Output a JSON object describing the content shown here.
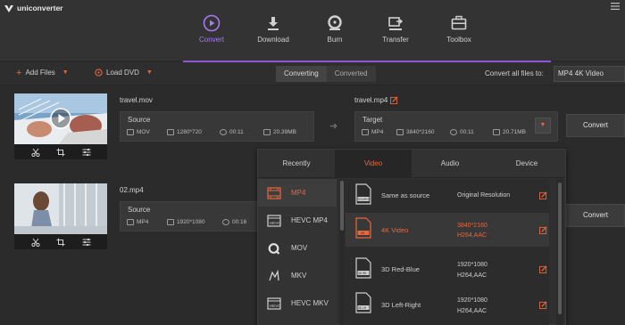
{
  "app": {
    "name": "uniconverter",
    "accent_color": "#8e59d8",
    "highlight_color": "#e8663e"
  },
  "nav": {
    "tabs": [
      {
        "label": "Convert",
        "icon": "convert-icon",
        "active": true
      },
      {
        "label": "Download",
        "icon": "download-icon",
        "active": false
      },
      {
        "label": "Burn",
        "icon": "burn-icon",
        "active": false
      },
      {
        "label": "Transfer",
        "icon": "transfer-icon",
        "active": false
      },
      {
        "label": "Toolbox",
        "icon": "toolbox-icon",
        "active": false
      }
    ]
  },
  "toolbar": {
    "add_files": "Add Files",
    "load_dvd": "Load DVD",
    "segments": [
      {
        "label": "Converting",
        "selected": true
      },
      {
        "label": "Converted",
        "selected": false
      }
    ],
    "convert_all_label": "Convert all files to:",
    "convert_all_value": "MP4 4K Video"
  },
  "files": [
    {
      "name": "travel.mov",
      "source": {
        "title": "Source",
        "format": "MOV",
        "resolution": "1280*720",
        "duration": "00:11",
        "size": "20.39MB"
      },
      "target_name": "travel.mp4",
      "target": {
        "title": "Target",
        "format": "MP4",
        "resolution": "3840*2160",
        "duration": "00:11",
        "size": "20.71MB"
      },
      "convert_label": "Convert"
    },
    {
      "name": "02.mp4",
      "source": {
        "title": "Source",
        "format": "MP4",
        "resolution": "1920*1080",
        "duration": "00:16"
      },
      "convert_label": "Convert"
    }
  ],
  "format_popup": {
    "tabs": [
      {
        "label": "Recently",
        "selected": false
      },
      {
        "label": "Video",
        "selected": true
      },
      {
        "label": "Audio",
        "selected": false
      },
      {
        "label": "Device",
        "selected": false
      }
    ],
    "formats": [
      {
        "label": "MP4",
        "icon": "mp4-film-icon",
        "selected": true
      },
      {
        "label": "HEVC MP4",
        "icon": "hevc-icon",
        "selected": false
      },
      {
        "label": "MOV",
        "icon": "quicktime-icon",
        "selected": false
      },
      {
        "label": "MKV",
        "icon": "mkv-icon",
        "selected": false
      },
      {
        "label": "HEVC MKV",
        "icon": "hevc-icon",
        "selected": false
      }
    ],
    "resolutions": [
      {
        "name": "Same as source",
        "value1": "Original Resolution",
        "value2": "",
        "badge": "SOURCE",
        "selected": false
      },
      {
        "name": "4K Video",
        "value1": "3840*2160",
        "value2": "H264,AAC",
        "badge": "4K",
        "selected": true
      },
      {
        "name": "3D Red-Blue",
        "value1": "1920*1080",
        "value2": "H264,AAC",
        "badge": "3D RB",
        "selected": false
      },
      {
        "name": "3D Left-Right",
        "value1": "1920*1080",
        "value2": "H264,AAC",
        "badge": "3D LR",
        "selected": false
      }
    ]
  }
}
